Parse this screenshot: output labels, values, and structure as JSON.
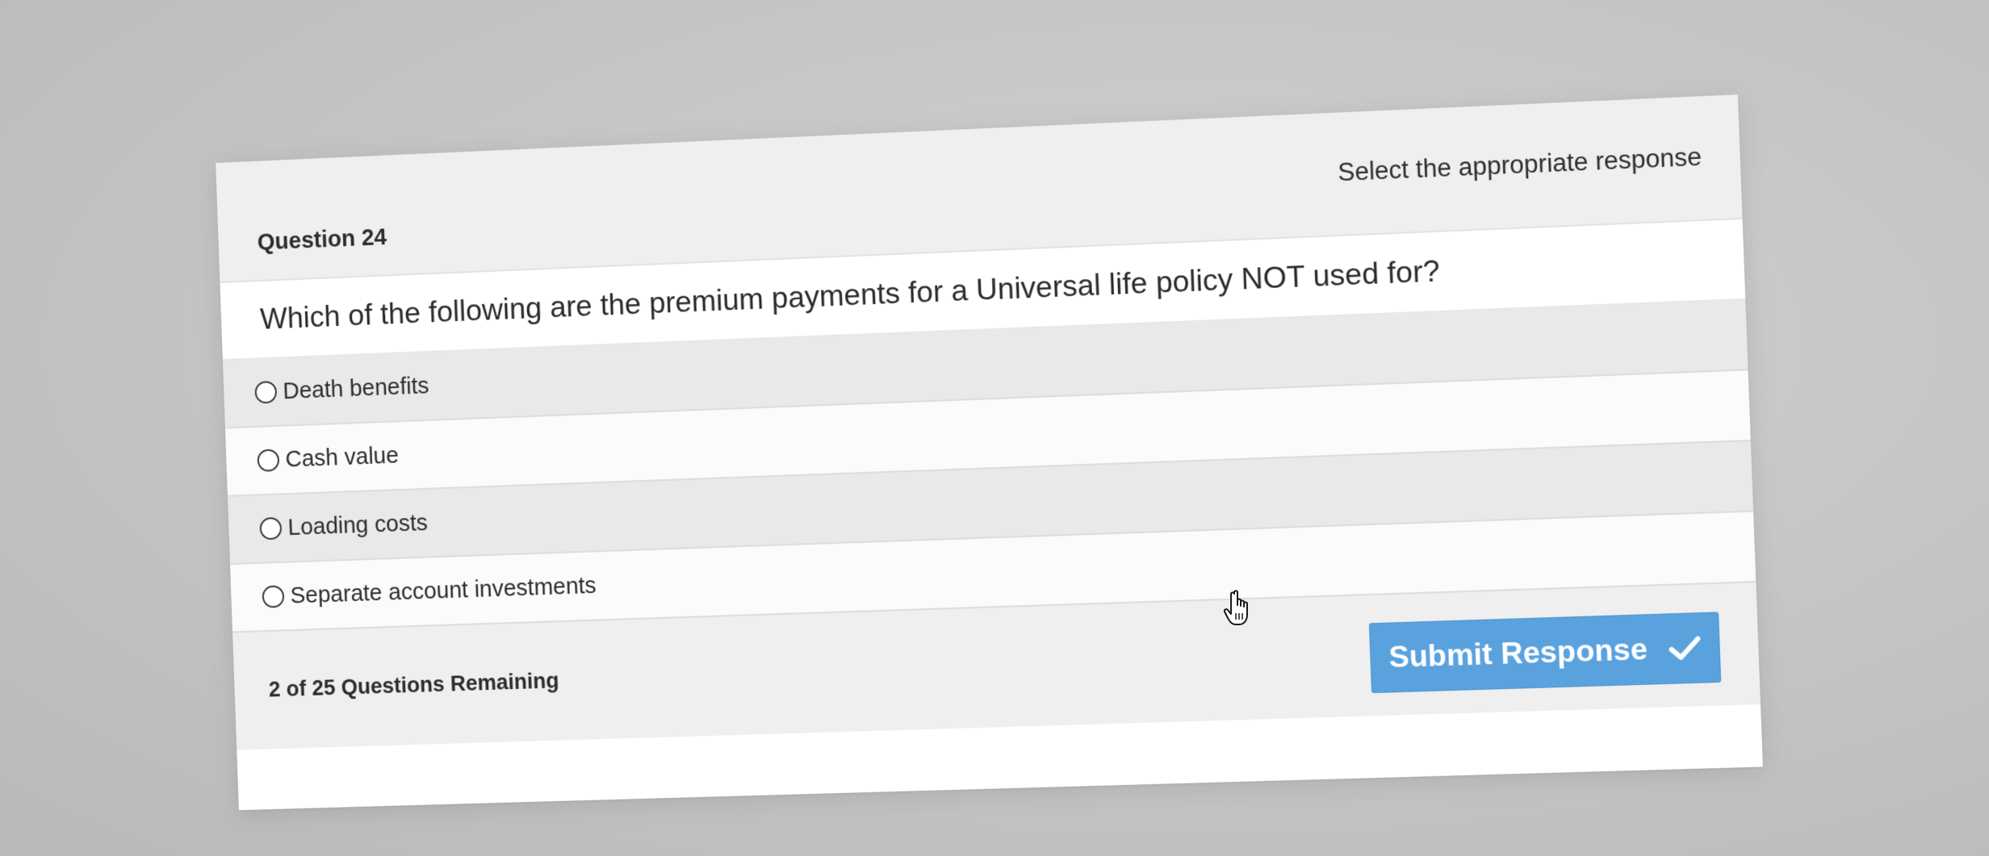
{
  "header": {
    "question_number": "Question 24",
    "instruction": "Select the appropriate response"
  },
  "question": {
    "text": "Which of the following are the premium payments for a Universal life policy NOT used for?"
  },
  "options": [
    {
      "label": "Death benefits"
    },
    {
      "label": "Cash value"
    },
    {
      "label": "Loading costs"
    },
    {
      "label": "Separate account investments"
    }
  ],
  "footer": {
    "remaining": "2 of 25 Questions Remaining",
    "submit_label": "Submit Response",
    "submit_icon": "checkmark-icon"
  },
  "colors": {
    "submit_button": "#5aa2de",
    "header_bg": "#efefef",
    "option_shaded": "#e9e9e9"
  },
  "cursor": "hand-pointer-icon"
}
